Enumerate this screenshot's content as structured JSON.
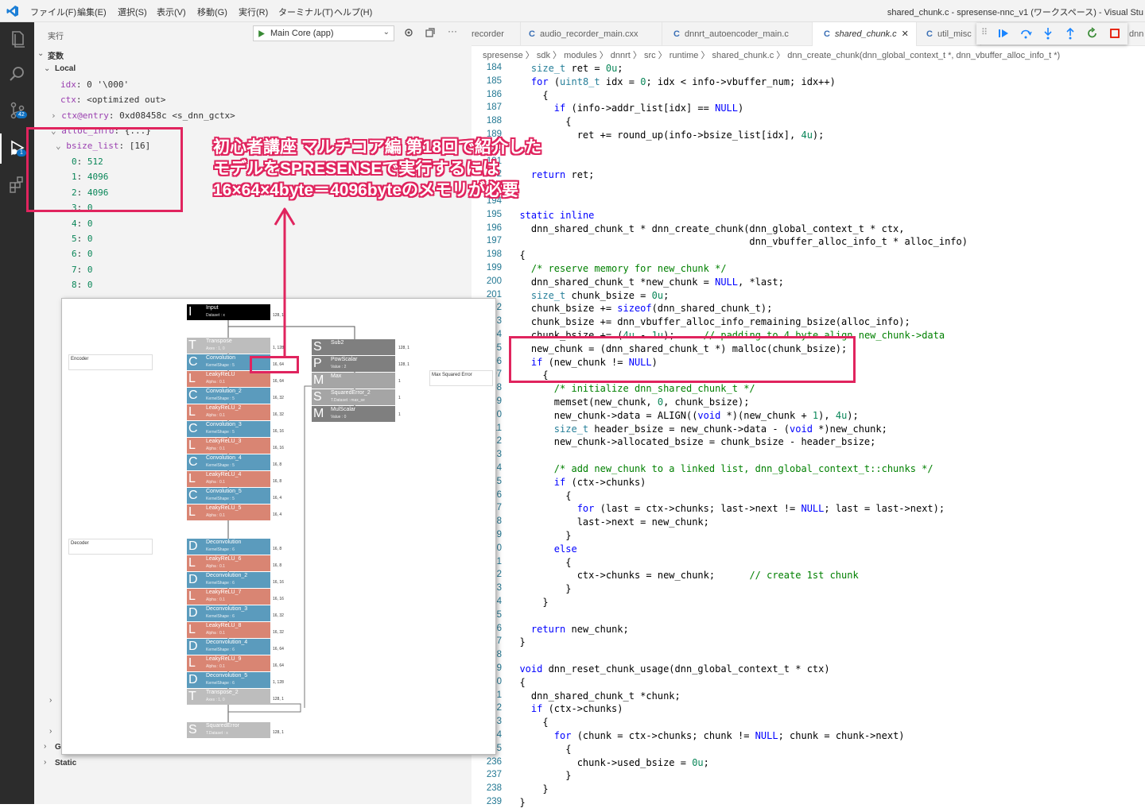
{
  "menu": [
    "ファイル(F)",
    "編集(E)",
    "選択(S)",
    "表示(V)",
    "移動(G)",
    "実行(R)",
    "ターミナル(T)",
    "ヘルプ(H)"
  ],
  "window_title": "shared_chunk.c - spresense-nnc_v1 (ワークスペース) - Visual Stu",
  "activity": {
    "scm_badge": "42",
    "debug_badge": "1"
  },
  "sidebar": {
    "title": "実行",
    "launch_config": "Main Core (app)",
    "section": "変数",
    "scope_local": "Local",
    "vars": [
      {
        "name": "idx",
        "value": "0 '\\000'"
      },
      {
        "name": "ctx",
        "value": "<optimized out>"
      },
      {
        "name": "ctx@entry",
        "value": "0xd08458c <s_dnn_gctx>"
      },
      {
        "name": "alloc_info",
        "value": "{...}"
      },
      {
        "name": "bsize_list",
        "value": "[16]"
      }
    ],
    "bsize_items": [
      {
        "idx": "0",
        "val": "512"
      },
      {
        "idx": "1",
        "val": "4096"
      },
      {
        "idx": "2",
        "val": "4096"
      },
      {
        "idx": "3",
        "val": "0"
      },
      {
        "idx": "4",
        "val": "0"
      },
      {
        "idx": "5",
        "val": "0"
      },
      {
        "idx": "6",
        "val": "0"
      },
      {
        "idx": "7",
        "val": "0"
      },
      {
        "idx": "8",
        "val": "0"
      }
    ],
    "scope_gl": "Gl",
    "scope_static": "Static"
  },
  "tabs": [
    {
      "label": "recorder"
    },
    {
      "label": "audio_recorder_main.cxx"
    },
    {
      "label": "dnnrt_autoencoder_main.c"
    },
    {
      "label": "shared_chunk.c"
    },
    {
      "label": "util_misc"
    },
    {
      "label": "dnn"
    }
  ],
  "breadcrumb": "spresense 〉 sdk 〉 modules 〉 dnnrt 〉 src 〉 runtime 〉  shared_chunk.c 〉  dnn_create_chunk(dnn_global_context_t *, dnn_vbuffer_alloc_info_t *)",
  "annotation": [
    "初心者講座 マルチコア編 第18回で紹介した",
    "モデルをSPRESENSEで実行するには",
    "16×64×4byte＝4096byteのメモリが必要"
  ],
  "nnc": {
    "input": {
      "name": "Input",
      "sub": "Dataset : x",
      "dim": "128, 1"
    },
    "encoder_label": "Encoder",
    "decoder_label": "Decoder",
    "max_sq_label": "Max Squared Error",
    "layers": [
      {
        "g": "T",
        "name": "Transpose",
        "sub": "Axes : 1, 0",
        "color": "#bdbdbd",
        "dim": "1, 128"
      },
      {
        "g": "C",
        "name": "Convolution",
        "sub": "KernelShape : 5",
        "color": "#5b9bbd",
        "dim": "16, 64"
      },
      {
        "g": "L",
        "name": "LeakyReLU",
        "sub": "Alpha : 0.1",
        "color": "#d98573",
        "dim": "16, 64"
      },
      {
        "g": "C",
        "name": "Convolution_2",
        "sub": "KernelShape : 5",
        "color": "#5b9bbd",
        "dim": "16, 32"
      },
      {
        "g": "L",
        "name": "LeakyReLU_2",
        "sub": "Alpha : 0.1",
        "color": "#d98573",
        "dim": "16, 32"
      },
      {
        "g": "C",
        "name": "Convolution_3",
        "sub": "KernelShape : 5",
        "color": "#5b9bbd",
        "dim": "16, 16"
      },
      {
        "g": "L",
        "name": "LeakyReLU_3",
        "sub": "Alpha : 0.1",
        "color": "#d98573",
        "dim": "16, 16"
      },
      {
        "g": "C",
        "name": "Convolution_4",
        "sub": "KernelShape : 5",
        "color": "#5b9bbd",
        "dim": "16, 8"
      },
      {
        "g": "L",
        "name": "LeakyReLU_4",
        "sub": "Alpha : 0.1",
        "color": "#d98573",
        "dim": "16, 8"
      },
      {
        "g": "C",
        "name": "Convolution_5",
        "sub": "KernelShape : 5",
        "color": "#5b9bbd",
        "dim": "16, 4"
      },
      {
        "g": "L",
        "name": "LeakyReLU_5",
        "sub": "Alpha : 0.1",
        "color": "#d98573",
        "dim": "16, 4"
      },
      {
        "g": "D",
        "name": "Deconvolution",
        "sub": "KernelShape : 6",
        "color": "#5b9bbd",
        "dim": "16, 8"
      },
      {
        "g": "L",
        "name": "LeakyReLU_6",
        "sub": "Alpha : 0.1",
        "color": "#d98573",
        "dim": "16, 8"
      },
      {
        "g": "D",
        "name": "Deconvolution_2",
        "sub": "KernelShape : 6",
        "color": "#5b9bbd",
        "dim": "16, 16"
      },
      {
        "g": "L",
        "name": "LeakyReLU_7",
        "sub": "Alpha : 0.1",
        "color": "#d98573",
        "dim": "16, 16"
      },
      {
        "g": "D",
        "name": "Deconvolution_3",
        "sub": "KernelShape : 6",
        "color": "#5b9bbd",
        "dim": "16, 32"
      },
      {
        "g": "L",
        "name": "LeakyReLU_8",
        "sub": "Alpha : 0.1",
        "color": "#d98573",
        "dim": "16, 32"
      },
      {
        "g": "D",
        "name": "Deconvolution_4",
        "sub": "KernelShape : 6",
        "color": "#5b9bbd",
        "dim": "16, 64"
      },
      {
        "g": "L",
        "name": "LeakyReLU_9",
        "sub": "Alpha : 0.1",
        "color": "#d98573",
        "dim": "16, 64"
      },
      {
        "g": "D",
        "name": "Deconvolution_5",
        "sub": "KernelShape : 6",
        "color": "#5b9bbd",
        "dim": "1, 128"
      },
      {
        "g": "T",
        "name": "Transpose_2",
        "sub": "Axes : 1, 0",
        "color": "#bdbdbd",
        "dim": "128, 1"
      },
      {
        "g": "S",
        "name": "SquaredError",
        "sub": "T.Dataset : x",
        "color": "#bdbdbd",
        "dim": "128, 1"
      }
    ],
    "right_layers": [
      {
        "g": "S",
        "name": "Sub2",
        "sub": "",
        "color": "#7f7f7f",
        "dim": "128, 1"
      },
      {
        "g": "P",
        "name": "PowScalar",
        "sub": "Value : 2",
        "color": "#7f7f7f",
        "dim": "128, 1"
      },
      {
        "g": "M",
        "name": "Max",
        "sub": "",
        "color": "#a5a5a5",
        "dim": "1"
      },
      {
        "g": "S",
        "name": "SquaredError_2",
        "sub": "T.Dataset : max_se",
        "color": "#a5a5a5",
        "dim": "1"
      },
      {
        "g": "M",
        "name": "MulScalar",
        "sub": "Value : 0",
        "color": "#7f7f7f",
        "dim": "1"
      }
    ]
  },
  "code": [
    {
      "n": "184",
      "t": "    <span class=ty>size_t</span> ret = <span class=nm>0u</span>;"
    },
    {
      "n": "185",
      "t": "    <span class=kw>for</span> (<span class=ty>uint8_t</span> idx = <span class=nm>0</span>; idx &lt; info-&gt;vbuffer_num; idx++)"
    },
    {
      "n": "186",
      "t": "      {"
    },
    {
      "n": "187",
      "t": "        <span class=kw>if</span> (info-&gt;addr_list[idx] == <span class=kw>NULL</span>)"
    },
    {
      "n": "188",
      "t": "          {"
    },
    {
      "n": "189",
      "t": "            ret += round_up(info-&gt;bsize_list[idx], <span class=nm>4u</span>);"
    },
    {
      "n": "190",
      "t": ""
    },
    {
      "n": "191",
      "t": ""
    },
    {
      "n": "192",
      "t": "    <span class=kw>return</span> ret;"
    },
    {
      "n": "193",
      "t": ""
    },
    {
      "n": "194",
      "t": ""
    },
    {
      "n": "195",
      "t": "  <span class=kw>static</span> <span class=kw>inline</span>"
    },
    {
      "n": "196",
      "t": "    dnn_shared_chunk_t * dnn_create_chunk(dnn_global_context_t * ctx,"
    },
    {
      "n": "197",
      "t": "                                          dnn_vbuffer_alloc_info_t * alloc_info)"
    },
    {
      "n": "198",
      "t": "  {"
    },
    {
      "n": "199",
      "t": "    <span class=cm>/* reserve memory for new_chunk */</span>"
    },
    {
      "n": "200",
      "t": "    dnn_shared_chunk_t *new_chunk = <span class=kw>NULL</span>, *last;"
    },
    {
      "n": "201",
      "t": "    <span class=ty>size_t</span> chunk_bsize = <span class=nm>0u</span>;"
    },
    {
      "n": "202",
      "t": "    chunk_bsize += <span class=kw>sizeof</span>(dnn_shared_chunk_t);"
    },
    {
      "n": "203",
      "t": "    chunk_bsize += dnn_vbuffer_alloc_info_remaining_bsize(alloc_info);"
    },
    {
      "n": "204",
      "t": "    chunk_bsize += (<span class=nm>4u</span> - <span class=nm>1u</span>);     <span class=cm>// padding to 4 byte align new_chunk-&gt;data</span>"
    },
    {
      "n": "205",
      "t": "    new_chunk = (dnn_shared_chunk_t *) malloc(chunk_bsize);"
    },
    {
      "n": "206",
      "t": "    <span class=kw>if</span> (new_chunk != <span class=kw>NULL</span>)"
    },
    {
      "n": "207",
      "t": "      {"
    },
    {
      "n": "208",
      "t": "        <span class=cm>/* initialize dnn_shared_chunk_t */</span>"
    },
    {
      "n": "209",
      "t": "        memset(new_chunk, <span class=nm>0</span>, chunk_bsize);"
    },
    {
      "n": "210",
      "t": "        new_chunk-&gt;data = ALIGN((<span class=kw>void</span> *)(new_chunk + <span class=nm>1</span>), <span class=nm>4u</span>);"
    },
    {
      "n": "211",
      "t": "        <span class=ty>size_t</span> header_bsize = new_chunk-&gt;data - (<span class=kw>void</span> *)new_chunk;"
    },
    {
      "n": "212",
      "t": "        new_chunk-&gt;allocated_bsize = chunk_bsize - header_bsize;"
    },
    {
      "n": "213",
      "t": ""
    },
    {
      "n": "214",
      "t": "        <span class=cm>/* add new_chunk to a linked list, dnn_global_context_t::chunks */</span>"
    },
    {
      "n": "215",
      "t": "        <span class=kw>if</span> (ctx-&gt;chunks)"
    },
    {
      "n": "216",
      "t": "          {"
    },
    {
      "n": "217",
      "t": "            <span class=kw>for</span> (last = ctx-&gt;chunks; last-&gt;next != <span class=kw>NULL</span>; last = last-&gt;next);"
    },
    {
      "n": "218",
      "t": "            last-&gt;next = new_chunk;"
    },
    {
      "n": "219",
      "t": "          }"
    },
    {
      "n": "220",
      "t": "        <span class=kw>else</span>"
    },
    {
      "n": "221",
      "t": "          {"
    },
    {
      "n": "222",
      "t": "            ctx-&gt;chunks = new_chunk;      <span class=cm>// create 1st chunk</span>"
    },
    {
      "n": "223",
      "t": "          }"
    },
    {
      "n": "224",
      "t": "      }"
    },
    {
      "n": "225",
      "t": ""
    },
    {
      "n": "226",
      "t": "    <span class=kw>return</span> new_chunk;"
    },
    {
      "n": "227",
      "t": "  }"
    },
    {
      "n": "228",
      "t": ""
    },
    {
      "n": "229",
      "t": "  <span class=kw>void</span> dnn_reset_chunk_usage(dnn_global_context_t * ctx)"
    },
    {
      "n": "230",
      "t": "  {"
    },
    {
      "n": "231",
      "t": "    dnn_shared_chunk_t *chunk;"
    },
    {
      "n": "232",
      "t": "    <span class=kw>if</span> (ctx-&gt;chunks)"
    },
    {
      "n": "233",
      "t": "      {"
    },
    {
      "n": "234",
      "t": "        <span class=kw>for</span> (chunk = ctx-&gt;chunks; chunk != <span class=kw>NULL</span>; chunk = chunk-&gt;next)"
    },
    {
      "n": "235",
      "t": "          {"
    },
    {
      "n": "236",
      "t": "            chunk-&gt;used_bsize = <span class=nm>0u</span>;"
    },
    {
      "n": "237",
      "t": "          }"
    },
    {
      "n": "238",
      "t": "      }"
    },
    {
      "n": "239",
      "t": "  }"
    }
  ]
}
